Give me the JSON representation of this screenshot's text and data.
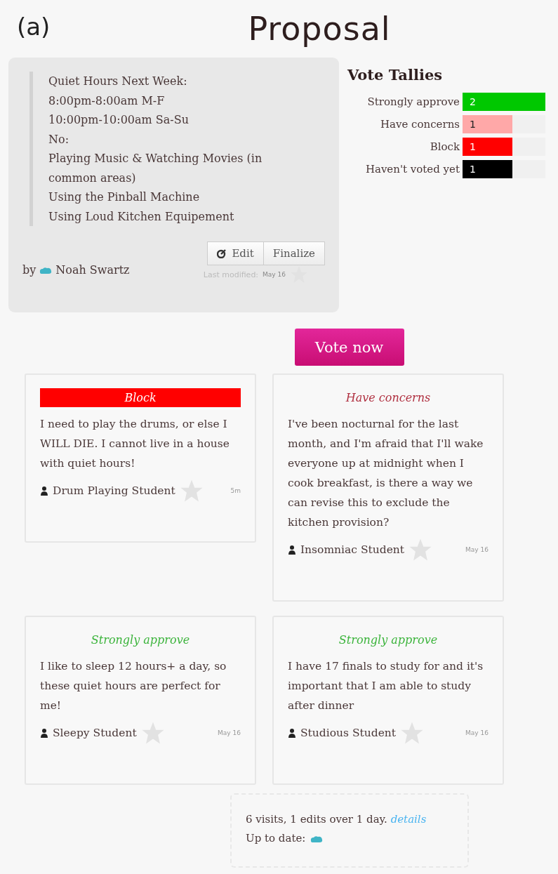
{
  "figure_label": "(a)",
  "title": "Proposal",
  "proposal": {
    "lines": [
      "Quiet Hours Next Week:",
      "8:00pm-8:00am M-F",
      "10:00pm-10:00am Sa-Su",
      "No:",
      "Playing Music & Watching Movies (in common areas)",
      "Using the Pinball Machine",
      "Using Loud Kitchen Equipement"
    ],
    "buttons": [
      "Edit",
      "Finalize"
    ],
    "by_label": "by",
    "author": "Noah Swartz",
    "last_modified_label": "Last modified:",
    "last_modified": "May 16"
  },
  "tallies": {
    "title": "Vote Tallies",
    "rows": [
      {
        "label": "Strongly approve",
        "count": "2",
        "color": "#00c800",
        "level": 1
      },
      {
        "label": "Have concerns",
        "count": "1",
        "color": "#ffa8a8",
        "level": 0.6
      },
      {
        "label": "Block",
        "count": "1",
        "color": "#ff0000",
        "level": 0.6
      },
      {
        "label": "Haven't voted yet",
        "count": "1",
        "color": "#000000",
        "level": 0.6
      }
    ]
  },
  "vote_button": "Vote now",
  "comments": [
    {
      "vote": "Block",
      "kind": "block",
      "text": "I need to play the drums, or else I WILL DIE. I cannot live in a house with quiet hours!",
      "author": "Drum Playing Student",
      "time": "5m"
    },
    {
      "vote": "Have concerns",
      "kind": "concerns",
      "text": "I've been nocturnal for the last month, and I'm afraid that I'll wake everyone up at midnight when I cook breakfast, is there a way we can revise this to exclude the kitchen provision?",
      "author": "Insomniac Student",
      "time": "May 16"
    },
    {
      "vote": "Strongly approve",
      "kind": "approve",
      "text": "I like to sleep 12 hours+ a day, so these quiet hours are perfect for me!",
      "author": "Sleepy Student",
      "time": "May 16"
    },
    {
      "vote": "Strongly approve",
      "kind": "approve",
      "text": "I have 17 finals to study for and it's important that I am able to study after dinner",
      "author": "Studious Student",
      "time": "May 16"
    }
  ],
  "stats": {
    "summary": "6 visits, 1 edits over 1 day.",
    "link": "details",
    "up_to_date_label": "Up to date:"
  }
}
